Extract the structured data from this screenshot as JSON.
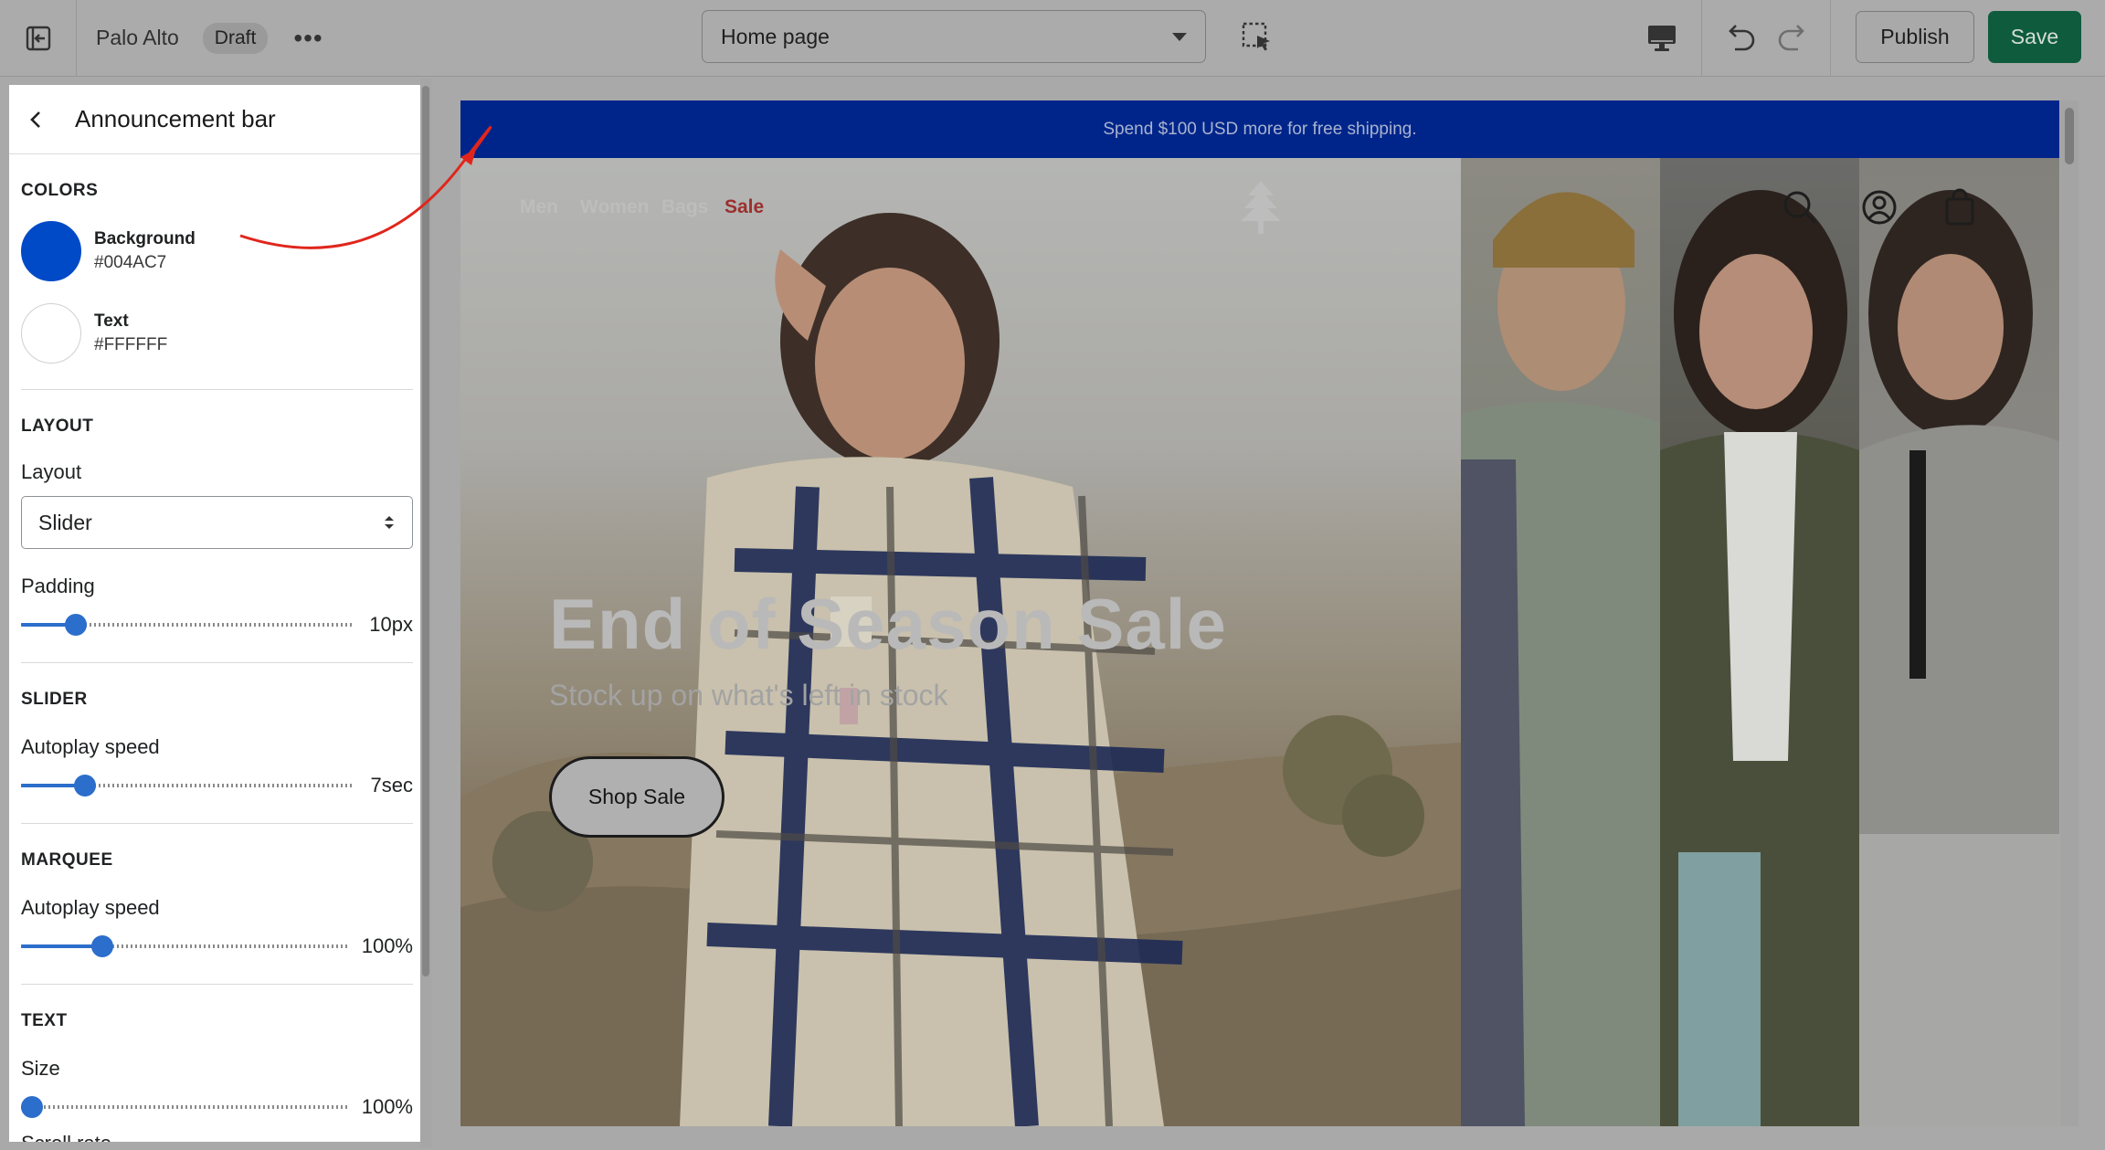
{
  "topbar": {
    "store_name": "Palo Alto",
    "status_badge": "Draft",
    "more_label": "•••",
    "page_select": "Home page",
    "publish_label": "Publish",
    "save_label": "Save",
    "icons": [
      "exit-icon",
      "more-icon",
      "inspector-icon",
      "desktop-icon",
      "undo-icon",
      "redo-icon"
    ]
  },
  "panel": {
    "title": "Announcement bar",
    "colors": {
      "label": "COLORS",
      "items": [
        {
          "name": "Background",
          "hex": "#004AC7"
        },
        {
          "name": "Text",
          "hex": "#FFFFFF"
        }
      ]
    },
    "layout": {
      "label": "LAYOUT",
      "field_label": "Layout",
      "value": "Slider",
      "padding_label": "Padding",
      "padding_value": "10px",
      "padding_fraction": 0.14
    },
    "slider": {
      "label": "SLIDER",
      "autoplay_label": "Autoplay speed",
      "autoplay_value": "7sec",
      "autoplay_fraction": 0.17
    },
    "marquee": {
      "label": "MARQUEE",
      "autoplay_label": "Autoplay speed",
      "autoplay_value": "100%",
      "autoplay_fraction": 0.23
    },
    "text": {
      "label": "TEXT",
      "size_label": "Size",
      "size_value": "100%",
      "size_fraction": 0.0,
      "next_label": "Scroll rate"
    }
  },
  "preview": {
    "announcement": "Spend $100 USD more for free shipping.",
    "nav": [
      "Men",
      "Women",
      "Bags",
      "Sale"
    ],
    "hero_title": "End of Season Sale",
    "hero_subtitle": "Stock up on what's left in stock",
    "hero_button": "Shop Sale",
    "icons": [
      "tree-logo-icon",
      "search-icon",
      "account-icon",
      "cart-icon"
    ]
  },
  "colors": {
    "save_green": "#0E5C3D",
    "accent_blue": "#2C6ECB",
    "annotation_red": "#E0261C"
  }
}
